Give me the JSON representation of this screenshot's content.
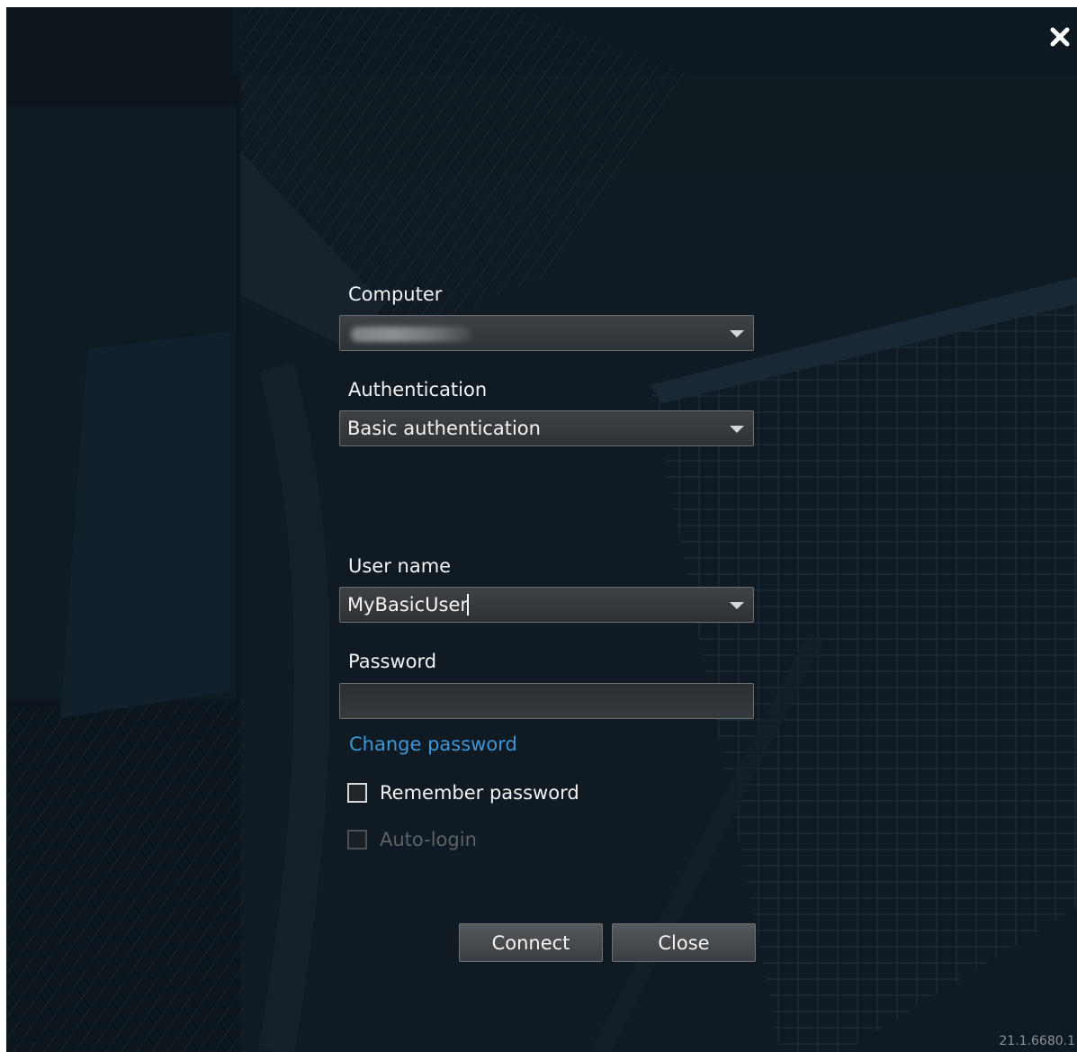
{
  "dialog": {
    "close_icon": "close-x-icon",
    "version": "21.1.6680.1"
  },
  "form": {
    "computer": {
      "label": "Computer",
      "value": ""
    },
    "authentication": {
      "label": "Authentication",
      "value": "Basic authentication"
    },
    "user_name": {
      "label": "User name",
      "value": "MyBasicUser"
    },
    "password": {
      "label": "Password",
      "value": ""
    },
    "change_password_link": "Change password",
    "remember_password": {
      "label": "Remember password",
      "checked": false
    },
    "auto_login": {
      "label": "Auto-login",
      "checked": false,
      "enabled": false
    }
  },
  "buttons": {
    "connect": "Connect",
    "close": "Close"
  },
  "colors": {
    "background": "#0f1a22",
    "link": "#3d97d8",
    "text": "#f2f2f2"
  }
}
